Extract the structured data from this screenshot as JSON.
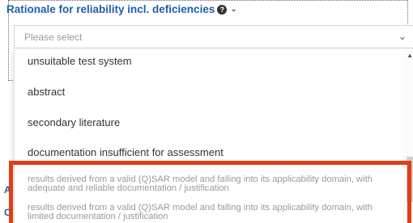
{
  "field": {
    "label": "Rationale for reliability incl. deficiencies",
    "help_icon": "question-circle-icon",
    "chevron_icon": "chevron-down-icon"
  },
  "select": {
    "placeholder": "Please select",
    "chevron_icon": "chevron-down-icon"
  },
  "dropdown": {
    "options": [
      "unsuitable test system",
      "abstract",
      "secondary literature",
      "documentation insufficient for assessment"
    ],
    "long_options": [
      {
        "line1": "results derived from a valid (Q)SAR model and falling into its applicability domain, with",
        "line2": "adequate and reliable documentation / justification"
      },
      {
        "line1": "results derived from a valid (Q)SAR model and falling into its applicability domain, with",
        "line2": "limited documentation / justification"
      }
    ],
    "scroll_up_icon": "triangle-up-icon"
  },
  "side_letters": [
    "A",
    "C"
  ],
  "colors": {
    "label": "#1f5fa8",
    "highlight": "#e63b12",
    "placeholder": "#9a9a9a"
  }
}
